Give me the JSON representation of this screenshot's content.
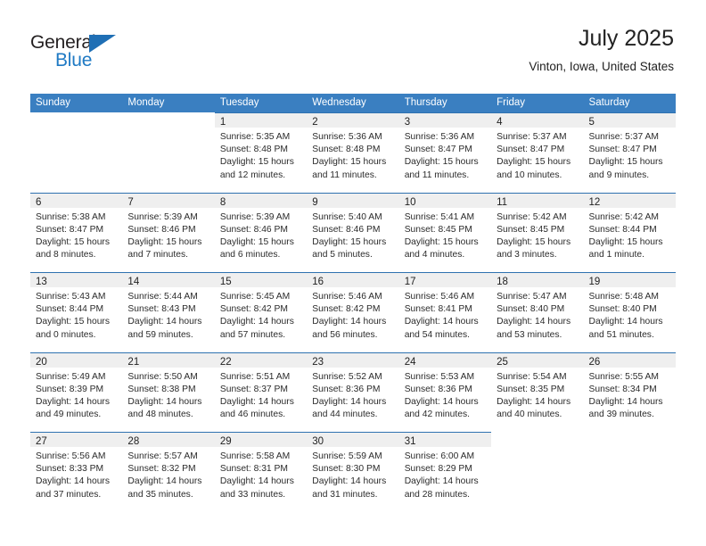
{
  "logo": {
    "word_top": "General",
    "word_bottom": "Blue",
    "triangle_color": "#1f6fb5",
    "blue_color": "#1f7ac4"
  },
  "header": {
    "title": "July 2025",
    "location": "Vinton, Iowa, United States"
  },
  "theme": {
    "header_row_bg": "#3a7fc1",
    "day_head_bg": "#efefef",
    "day_head_border": "#2f72b0"
  },
  "weekday_headers": [
    "Sunday",
    "Monday",
    "Tuesday",
    "Wednesday",
    "Thursday",
    "Friday",
    "Saturday"
  ],
  "weeks": [
    [
      {
        "day": "",
        "lines": [
          "",
          "",
          "",
          ""
        ]
      },
      {
        "day": "",
        "lines": [
          "",
          "",
          "",
          ""
        ]
      },
      {
        "day": "1",
        "lines": [
          "Sunrise: 5:35 AM",
          "Sunset: 8:48 PM",
          "Daylight: 15 hours",
          "and 12 minutes."
        ]
      },
      {
        "day": "2",
        "lines": [
          "Sunrise: 5:36 AM",
          "Sunset: 8:48 PM",
          "Daylight: 15 hours",
          "and 11 minutes."
        ]
      },
      {
        "day": "3",
        "lines": [
          "Sunrise: 5:36 AM",
          "Sunset: 8:47 PM",
          "Daylight: 15 hours",
          "and 11 minutes."
        ]
      },
      {
        "day": "4",
        "lines": [
          "Sunrise: 5:37 AM",
          "Sunset: 8:47 PM",
          "Daylight: 15 hours",
          "and 10 minutes."
        ]
      },
      {
        "day": "5",
        "lines": [
          "Sunrise: 5:37 AM",
          "Sunset: 8:47 PM",
          "Daylight: 15 hours",
          "and 9 minutes."
        ]
      }
    ],
    [
      {
        "day": "6",
        "lines": [
          "Sunrise: 5:38 AM",
          "Sunset: 8:47 PM",
          "Daylight: 15 hours",
          "and 8 minutes."
        ]
      },
      {
        "day": "7",
        "lines": [
          "Sunrise: 5:39 AM",
          "Sunset: 8:46 PM",
          "Daylight: 15 hours",
          "and 7 minutes."
        ]
      },
      {
        "day": "8",
        "lines": [
          "Sunrise: 5:39 AM",
          "Sunset: 8:46 PM",
          "Daylight: 15 hours",
          "and 6 minutes."
        ]
      },
      {
        "day": "9",
        "lines": [
          "Sunrise: 5:40 AM",
          "Sunset: 8:46 PM",
          "Daylight: 15 hours",
          "and 5 minutes."
        ]
      },
      {
        "day": "10",
        "lines": [
          "Sunrise: 5:41 AM",
          "Sunset: 8:45 PM",
          "Daylight: 15 hours",
          "and 4 minutes."
        ]
      },
      {
        "day": "11",
        "lines": [
          "Sunrise: 5:42 AM",
          "Sunset: 8:45 PM",
          "Daylight: 15 hours",
          "and 3 minutes."
        ]
      },
      {
        "day": "12",
        "lines": [
          "Sunrise: 5:42 AM",
          "Sunset: 8:44 PM",
          "Daylight: 15 hours",
          "and 1 minute."
        ]
      }
    ],
    [
      {
        "day": "13",
        "lines": [
          "Sunrise: 5:43 AM",
          "Sunset: 8:44 PM",
          "Daylight: 15 hours",
          "and 0 minutes."
        ]
      },
      {
        "day": "14",
        "lines": [
          "Sunrise: 5:44 AM",
          "Sunset: 8:43 PM",
          "Daylight: 14 hours",
          "and 59 minutes."
        ]
      },
      {
        "day": "15",
        "lines": [
          "Sunrise: 5:45 AM",
          "Sunset: 8:42 PM",
          "Daylight: 14 hours",
          "and 57 minutes."
        ]
      },
      {
        "day": "16",
        "lines": [
          "Sunrise: 5:46 AM",
          "Sunset: 8:42 PM",
          "Daylight: 14 hours",
          "and 56 minutes."
        ]
      },
      {
        "day": "17",
        "lines": [
          "Sunrise: 5:46 AM",
          "Sunset: 8:41 PM",
          "Daylight: 14 hours",
          "and 54 minutes."
        ]
      },
      {
        "day": "18",
        "lines": [
          "Sunrise: 5:47 AM",
          "Sunset: 8:40 PM",
          "Daylight: 14 hours",
          "and 53 minutes."
        ]
      },
      {
        "day": "19",
        "lines": [
          "Sunrise: 5:48 AM",
          "Sunset: 8:40 PM",
          "Daylight: 14 hours",
          "and 51 minutes."
        ]
      }
    ],
    [
      {
        "day": "20",
        "lines": [
          "Sunrise: 5:49 AM",
          "Sunset: 8:39 PM",
          "Daylight: 14 hours",
          "and 49 minutes."
        ]
      },
      {
        "day": "21",
        "lines": [
          "Sunrise: 5:50 AM",
          "Sunset: 8:38 PM",
          "Daylight: 14 hours",
          "and 48 minutes."
        ]
      },
      {
        "day": "22",
        "lines": [
          "Sunrise: 5:51 AM",
          "Sunset: 8:37 PM",
          "Daylight: 14 hours",
          "and 46 minutes."
        ]
      },
      {
        "day": "23",
        "lines": [
          "Sunrise: 5:52 AM",
          "Sunset: 8:36 PM",
          "Daylight: 14 hours",
          "and 44 minutes."
        ]
      },
      {
        "day": "24",
        "lines": [
          "Sunrise: 5:53 AM",
          "Sunset: 8:36 PM",
          "Daylight: 14 hours",
          "and 42 minutes."
        ]
      },
      {
        "day": "25",
        "lines": [
          "Sunrise: 5:54 AM",
          "Sunset: 8:35 PM",
          "Daylight: 14 hours",
          "and 40 minutes."
        ]
      },
      {
        "day": "26",
        "lines": [
          "Sunrise: 5:55 AM",
          "Sunset: 8:34 PM",
          "Daylight: 14 hours",
          "and 39 minutes."
        ]
      }
    ],
    [
      {
        "day": "27",
        "lines": [
          "Sunrise: 5:56 AM",
          "Sunset: 8:33 PM",
          "Daylight: 14 hours",
          "and 37 minutes."
        ]
      },
      {
        "day": "28",
        "lines": [
          "Sunrise: 5:57 AM",
          "Sunset: 8:32 PM",
          "Daylight: 14 hours",
          "and 35 minutes."
        ]
      },
      {
        "day": "29",
        "lines": [
          "Sunrise: 5:58 AM",
          "Sunset: 8:31 PM",
          "Daylight: 14 hours",
          "and 33 minutes."
        ]
      },
      {
        "day": "30",
        "lines": [
          "Sunrise: 5:59 AM",
          "Sunset: 8:30 PM",
          "Daylight: 14 hours",
          "and 31 minutes."
        ]
      },
      {
        "day": "31",
        "lines": [
          "Sunrise: 6:00 AM",
          "Sunset: 8:29 PM",
          "Daylight: 14 hours",
          "and 28 minutes."
        ]
      },
      {
        "day": "",
        "lines": [
          "",
          "",
          "",
          ""
        ]
      },
      {
        "day": "",
        "lines": [
          "",
          "",
          "",
          ""
        ]
      }
    ]
  ]
}
